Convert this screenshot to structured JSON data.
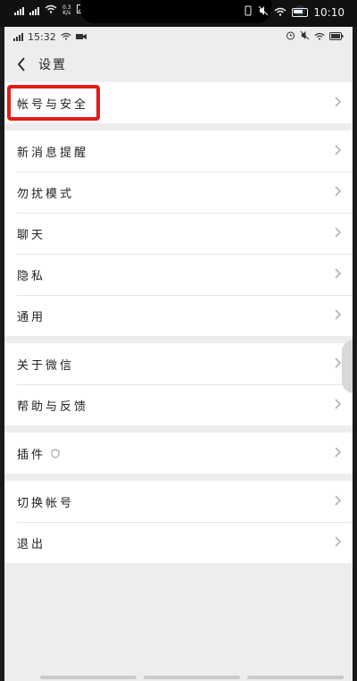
{
  "outer_status": {
    "time": "10:10",
    "net_speed": "0.3\nK/s"
  },
  "inner_status": {
    "time": "15:32"
  },
  "header": {
    "title": "设置",
    "back_icon": "chevron-left-icon"
  },
  "groups": [
    [
      {
        "name": "account-security",
        "label": "帐号与安全"
      }
    ],
    [
      {
        "name": "new-message-notification",
        "label": "新消息提醒"
      },
      {
        "name": "do-not-disturb",
        "label": "勿扰模式"
      },
      {
        "name": "chat",
        "label": "聊天"
      },
      {
        "name": "privacy",
        "label": "隐私"
      },
      {
        "name": "general",
        "label": "通用"
      }
    ],
    [
      {
        "name": "about-wechat",
        "label": "关于微信"
      },
      {
        "name": "help-feedback",
        "label": "帮助与反馈"
      }
    ],
    [
      {
        "name": "plugins",
        "label": "插件",
        "badge_icon": "shield-icon"
      }
    ],
    [
      {
        "name": "switch-account",
        "label": "切换帐号"
      },
      {
        "name": "logout",
        "label": "退出"
      }
    ]
  ],
  "colors": {
    "highlight": "#e41b17",
    "background": "#ededed",
    "row_background": "#ffffff"
  }
}
